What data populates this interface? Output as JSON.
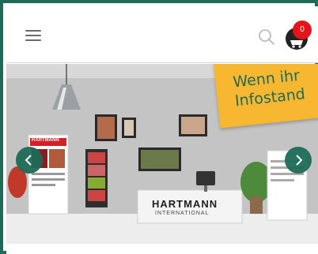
{
  "header": {
    "cart_count": "0"
  },
  "hero": {
    "banner_line1": "Wenn ihr",
    "banner_line2": "Infostand",
    "booth_brand": "HARTMANN",
    "booth_subbrand": "INTERNATIONAL",
    "poster_brand": "HARTMANN"
  },
  "colors": {
    "brand_green": "#1e6b58",
    "banner_yellow": "#f7b731",
    "badge_red": "#e3151b"
  },
  "icons": {
    "menu": "hamburger-icon",
    "search": "search-icon",
    "cart": "cart-icon",
    "prev": "chevron-left-icon",
    "next": "chevron-right-icon"
  }
}
